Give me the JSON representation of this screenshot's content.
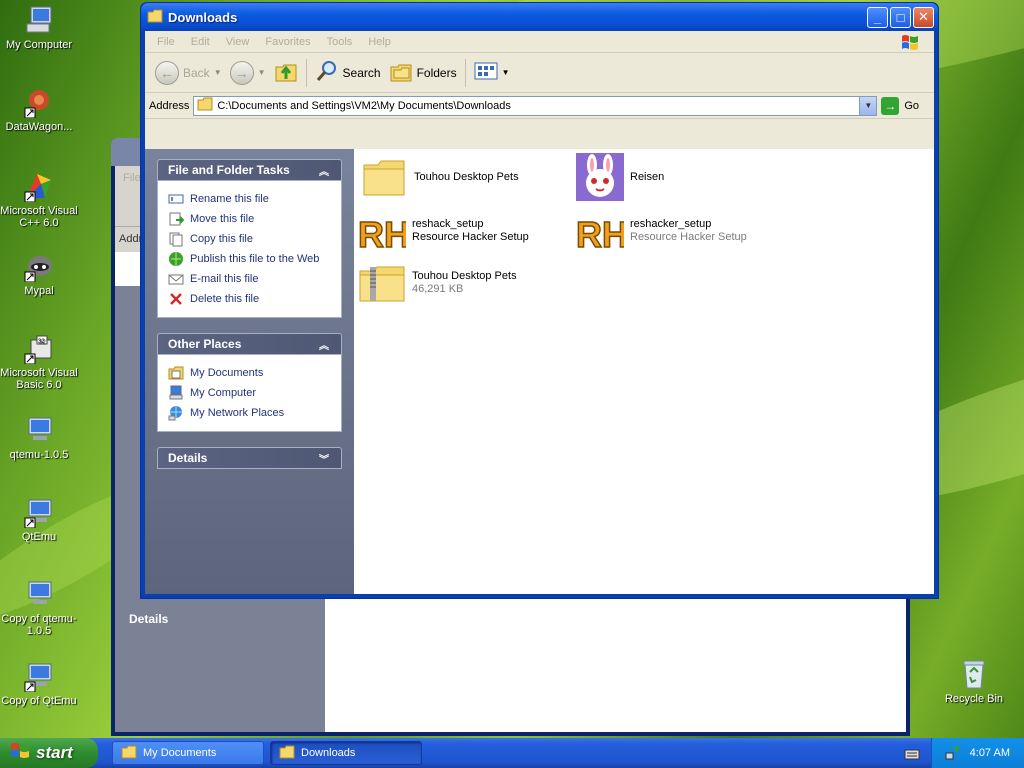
{
  "desktop": {
    "icons": [
      {
        "label": "My Computer",
        "icon": "my-computer-icon"
      },
      {
        "label": "DataWagon...",
        "icon": "datawagon-icon"
      },
      {
        "label": "Microsoft Visual C++ 6.0",
        "icon": "visual-cpp-icon"
      },
      {
        "label": "Mypal",
        "icon": "mypal-icon"
      },
      {
        "label": "Microsoft Visual Basic 6.0",
        "icon": "visual-basic-icon"
      },
      {
        "label": "qtemu-1.0.5",
        "icon": "qtemu-icon"
      },
      {
        "label": "QtEmu",
        "icon": "qtemu-shortcut-icon"
      },
      {
        "label": "Copy of qtemu-1.0.5",
        "icon": "qtemu-copy-icon"
      },
      {
        "label": "Copy of QtEmu",
        "icon": "qtemu-copy-shortcut-icon"
      },
      {
        "label": "Recycle Bin",
        "icon": "recycle-bin-icon"
      }
    ]
  },
  "background_window": {
    "menu_first": "File",
    "address_label": "Addr",
    "details_label": "Details"
  },
  "window": {
    "title": "Downloads",
    "menu": [
      "File",
      "Edit",
      "View",
      "Favorites",
      "Tools",
      "Help"
    ],
    "toolbar": {
      "back": "Back",
      "search": "Search",
      "folders": "Folders"
    },
    "address": {
      "label": "Address",
      "value": "C:\\Documents and Settings\\VM2\\My Documents\\Downloads",
      "go": "Go"
    },
    "tasks_panel": {
      "title": "File and Folder Tasks",
      "items": [
        {
          "label": "Rename this file",
          "icon": "rename-icon"
        },
        {
          "label": "Move this file",
          "icon": "move-icon"
        },
        {
          "label": "Copy this file",
          "icon": "copy-icon"
        },
        {
          "label": "Publish this file to the Web",
          "icon": "publish-web-icon"
        },
        {
          "label": "E-mail this file",
          "icon": "email-icon"
        },
        {
          "label": "Delete this file",
          "icon": "delete-icon"
        }
      ]
    },
    "places_panel": {
      "title": "Other Places",
      "items": [
        {
          "label": "My Documents",
          "icon": "my-documents-icon"
        },
        {
          "label": "My Computer",
          "icon": "my-computer-icon"
        },
        {
          "label": "My Network Places",
          "icon": "network-places-icon"
        }
      ]
    },
    "details_panel": {
      "title": "Details"
    },
    "files": [
      {
        "name": "Touhou Desktop Pets",
        "sub": "",
        "icon": "folder-icon"
      },
      {
        "name": "Reisen",
        "sub": "",
        "icon": "rabbit-icon"
      },
      {
        "name": "reshack_setup",
        "sub": "Resource Hacker Setup",
        "icon": "resource-hacker-icon"
      },
      {
        "name": "reshacker_setup",
        "sub": "Resource Hacker Setup",
        "icon": "resource-hacker-icon"
      },
      {
        "name": "Touhou Desktop Pets",
        "sub": "46,291 KB",
        "icon": "zip-folder-icon"
      }
    ]
  },
  "taskbar": {
    "start": "start",
    "buttons": [
      {
        "label": "My Documents",
        "active": false
      },
      {
        "label": "Downloads",
        "active": true
      }
    ],
    "clock": "4:07 AM"
  },
  "colors": {
    "xp_blue": "#0a5ce0",
    "start_green": "#2d8c2d",
    "taskpane": "#6b7490",
    "link": "#21347a"
  }
}
